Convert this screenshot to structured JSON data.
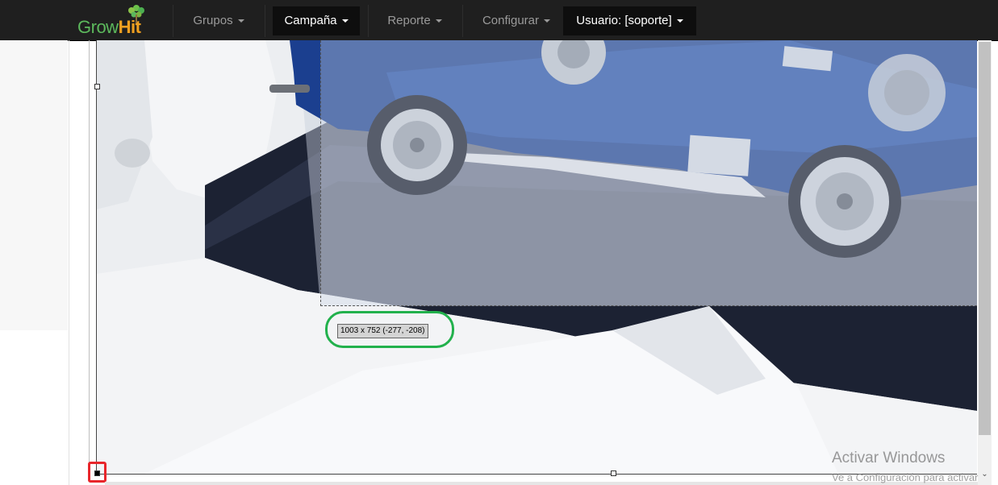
{
  "app": {
    "logo_grow": "Grow",
    "logo_hit": "Hit"
  },
  "nav": {
    "items": [
      {
        "label": "Grupos",
        "active": false
      },
      {
        "label": "Campaña",
        "active": true
      },
      {
        "label": "Reporte",
        "active": false
      },
      {
        "label": "Configurar",
        "active": false
      },
      {
        "label": "Usuario: [soporte]",
        "active": true
      }
    ]
  },
  "editor": {
    "selection_label": "1003 x 752 (-277, -208)"
  },
  "watermark": {
    "title": "Activar Windows",
    "subtitle": "Ve a Configuración para activar"
  },
  "colors": {
    "navbar": "#1f1f1f",
    "active_nav": "#0e0e0e",
    "highlight_green": "#22b14c",
    "highlight_red": "#e8262b"
  }
}
